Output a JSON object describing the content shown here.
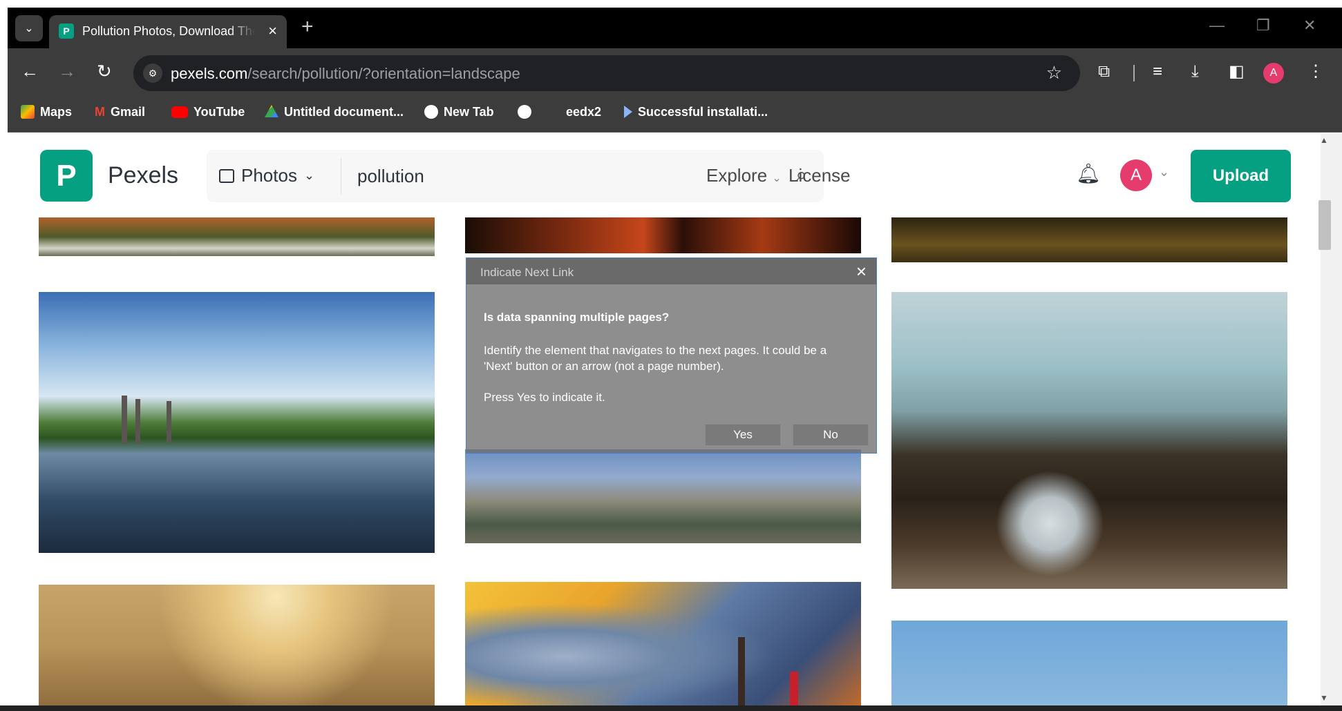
{
  "browser": {
    "tab_title": "Pollution Photos, Download The BEST Free Pollution Stock Photos & HD Images",
    "tab_favicon": "pexels-icon",
    "new_tab_symbol": "+",
    "url_host": "pexels.com",
    "url_path": "/search/pollution/?orientation=landscape",
    "profile_initial": "A",
    "bookmarks": [
      {
        "label": "Maps",
        "icon": "maps-icon",
        "color": "#34a853"
      },
      {
        "label": "Gmail",
        "icon": "gmail-icon",
        "color": "#ea4335"
      },
      {
        "label": "YouTube",
        "icon": "youtube-icon",
        "color": "#ff0000"
      },
      {
        "label": "Untitled document...",
        "icon": "drive-icon",
        "color": "#fbbc04"
      },
      {
        "label": "New Tab",
        "icon": "globe-icon",
        "color": "#ffffff"
      },
      {
        "label": "",
        "icon": "globe-icon",
        "color": "#ffffff"
      },
      {
        "label": "eedx2",
        "icon": "",
        "color": ""
      },
      {
        "label": "Successful installati...",
        "icon": "play-icon",
        "color": "#ffffff"
      }
    ]
  },
  "header": {
    "logo_letter": "P",
    "logo_text": "Pexels",
    "search_type": "Photos",
    "search_value": "pollution",
    "explore": "Explore",
    "license": "License",
    "user_initial": "A",
    "upload": "Upload"
  },
  "dialog": {
    "title": "Indicate Next Link",
    "question": "Is data spanning multiple pages?",
    "body": "Identify the element that navigates to the next pages. It could be a 'Next' button or an arrow (not a page number).",
    "prompt": "Press Yes to indicate it.",
    "yes": "Yes",
    "no": "No"
  },
  "colors": {
    "brand": "#05a081",
    "avatar": "#e53b6d"
  }
}
